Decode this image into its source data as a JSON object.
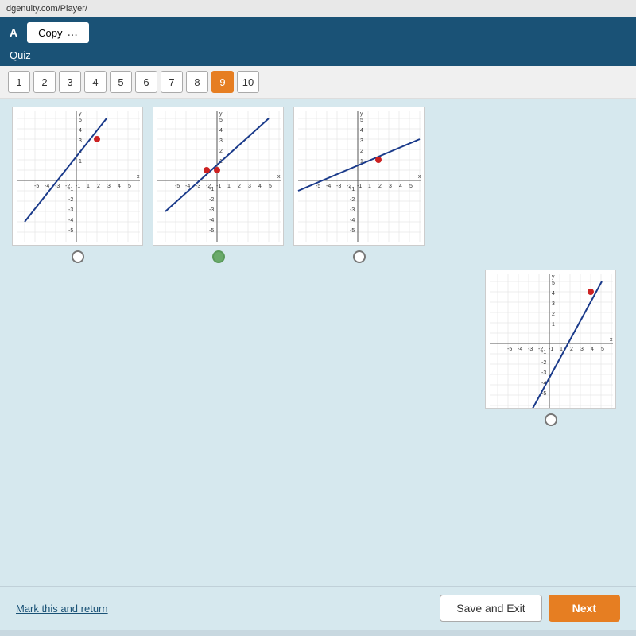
{
  "browser": {
    "url": "dgenuity.com/Player/"
  },
  "header": {
    "section": "A",
    "copy_label": "Copy",
    "dots": "..."
  },
  "quiz": {
    "label": "Quiz"
  },
  "question_nav": {
    "numbers": [
      "1",
      "2",
      "3",
      "4",
      "5",
      "6",
      "7",
      "8",
      "9",
      "10"
    ],
    "active": 9
  },
  "footer": {
    "mark_label": "Mark this and return",
    "save_exit_label": "Save and Exit",
    "next_label": "Next"
  }
}
